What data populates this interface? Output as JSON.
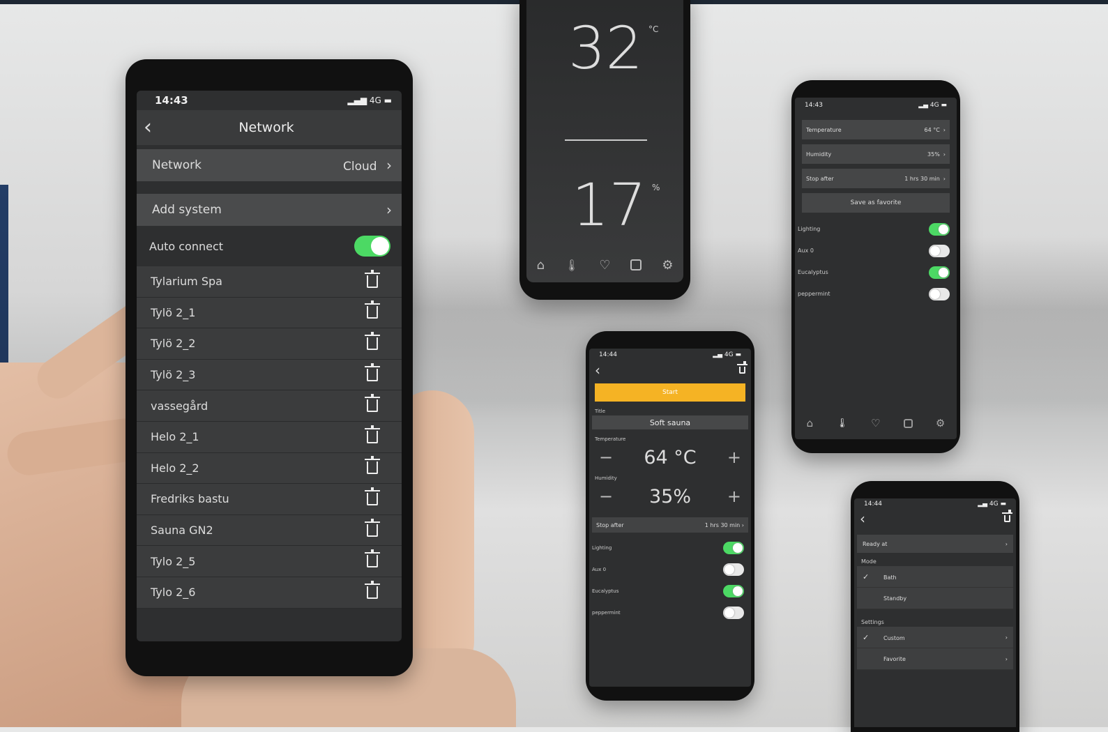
{
  "phone_main": {
    "status": {
      "time": "14:43",
      "network": "4G"
    },
    "header": {
      "title": "Network"
    },
    "network_row": {
      "label": "Network",
      "value": "Cloud"
    },
    "add_system": {
      "label": "Add system"
    },
    "auto_connect": {
      "label": "Auto connect",
      "on": true
    },
    "systems": [
      "Tylarium Spa",
      "Tylö 2_1",
      "Tylö 2_2",
      "Tylö 2_3",
      "vassegård",
      "Helo 2_1",
      "Helo 2_2",
      "Fredriks bastu",
      "Sauna GN2",
      "Tylo 2_5",
      "Tylo 2_6"
    ]
  },
  "phone_top": {
    "temperature": "32",
    "temp_unit": "°C",
    "humidity": "17",
    "hum_unit": "%"
  },
  "phone_right": {
    "status": {
      "time": "14:43",
      "network": "4G"
    },
    "rows": [
      {
        "label": "Temperature",
        "value": "64 °C"
      },
      {
        "label": "Humidity",
        "value": "35%"
      },
      {
        "label": "Stop after",
        "value": "1 hrs 30 min"
      }
    ],
    "save_label": "Save as favorite",
    "toggles": [
      {
        "label": "Lighting",
        "on": true
      },
      {
        "label": "Aux 0",
        "on": false
      },
      {
        "label": "Eucalyptus",
        "on": true
      },
      {
        "label": "peppermint",
        "on": false
      }
    ]
  },
  "phone_mid": {
    "status": {
      "time": "14:44",
      "network": "4G"
    },
    "start_label": "Start",
    "title_label": "Title",
    "title_value": "Soft sauna",
    "temperature_label": "Temperature",
    "temperature_value": "64 °C",
    "humidity_label": "Humidity",
    "humidity_value": "35%",
    "stop_label": "Stop after",
    "stop_value": "1 hrs 30 min",
    "toggles": [
      {
        "label": "Lighting",
        "on": true
      },
      {
        "label": "Aux 0",
        "on": false
      },
      {
        "label": "Eucalyptus",
        "on": true
      },
      {
        "label": "peppermint",
        "on": false
      }
    ]
  },
  "phone_br": {
    "status": {
      "time": "14:44",
      "network": "4G"
    },
    "ready_label": "Ready at",
    "mode_label": "Mode",
    "mode_options": [
      "Bath",
      "Standby"
    ],
    "settings_label": "Settings",
    "settings_options": [
      "Custom",
      "Favorite"
    ]
  },
  "colors": {
    "accent_green": "#4cd964",
    "start_yellow": "#f5b324",
    "screen_bg": "#2e2f30"
  }
}
